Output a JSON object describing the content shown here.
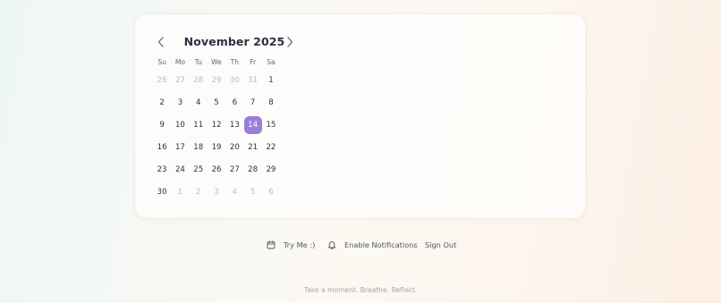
{
  "calendar": {
    "month_label": "November 2025",
    "weekdays": [
      "Su",
      "Mo",
      "Tu",
      "We",
      "Th",
      "Fr",
      "Sa"
    ],
    "weeks": [
      [
        {
          "d": "26",
          "muted": true
        },
        {
          "d": "27",
          "muted": true
        },
        {
          "d": "28",
          "muted": true
        },
        {
          "d": "29",
          "muted": true
        },
        {
          "d": "30",
          "muted": true
        },
        {
          "d": "31",
          "muted": true
        },
        {
          "d": "1"
        }
      ],
      [
        {
          "d": "2"
        },
        {
          "d": "3"
        },
        {
          "d": "4"
        },
        {
          "d": "5"
        },
        {
          "d": "6"
        },
        {
          "d": "7"
        },
        {
          "d": "8"
        }
      ],
      [
        {
          "d": "9"
        },
        {
          "d": "10"
        },
        {
          "d": "11"
        },
        {
          "d": "12"
        },
        {
          "d": "13"
        },
        {
          "d": "14",
          "selected": true
        },
        {
          "d": "15"
        }
      ],
      [
        {
          "d": "16"
        },
        {
          "d": "17"
        },
        {
          "d": "18"
        },
        {
          "d": "19"
        },
        {
          "d": "20"
        },
        {
          "d": "21"
        },
        {
          "d": "22"
        }
      ],
      [
        {
          "d": "23"
        },
        {
          "d": "24"
        },
        {
          "d": "25"
        },
        {
          "d": "26"
        },
        {
          "d": "27"
        },
        {
          "d": "28"
        },
        {
          "d": "29"
        }
      ],
      [
        {
          "d": "30"
        },
        {
          "d": "1",
          "muted": true
        },
        {
          "d": "2",
          "muted": true
        },
        {
          "d": "3",
          "muted": true
        },
        {
          "d": "4",
          "muted": true
        },
        {
          "d": "5",
          "muted": true
        },
        {
          "d": "6",
          "muted": true
        }
      ]
    ],
    "prev_icon": "chevron-left-icon",
    "next_icon": "chevron-right-icon"
  },
  "actions": {
    "try_me": {
      "label": "Try Me :)",
      "icon": "calendar-icon"
    },
    "notifications": {
      "label": "Enable Notifications",
      "icon": "bell-icon"
    },
    "sign_out": {
      "label": "Sign Out"
    }
  },
  "footer": {
    "text": "Take a moment. Breathe. Reflect."
  },
  "colors": {
    "accent": "#9b7fd6",
    "text": "#2b3245",
    "muted": "#b9bcc4"
  }
}
